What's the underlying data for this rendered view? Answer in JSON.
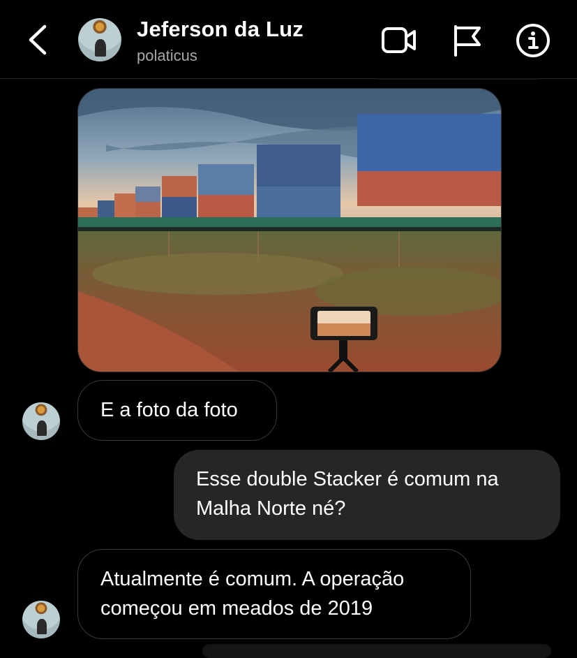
{
  "header": {
    "name": "Jeferson da Luz",
    "username": "polaticus"
  },
  "messages": [
    {
      "side": "incoming",
      "text": "E a foto da foto"
    },
    {
      "side": "outgoing",
      "lines": [
        "Esse double Stacker é comum na",
        "Malha Norte né?"
      ]
    },
    {
      "side": "incoming",
      "lines": [
        "Atualmente é comum. A operação",
        "começou em meados de 2019"
      ]
    }
  ],
  "icons": {
    "back": "chevron-left-icon",
    "video": "video-camera-icon",
    "flag": "flag-icon",
    "info": "info-icon"
  },
  "colors": {
    "background": "#000000",
    "outgoing_bubble": "#262626",
    "incoming_border": "#3a3a3a",
    "secondary_text": "#a8a8a8"
  }
}
